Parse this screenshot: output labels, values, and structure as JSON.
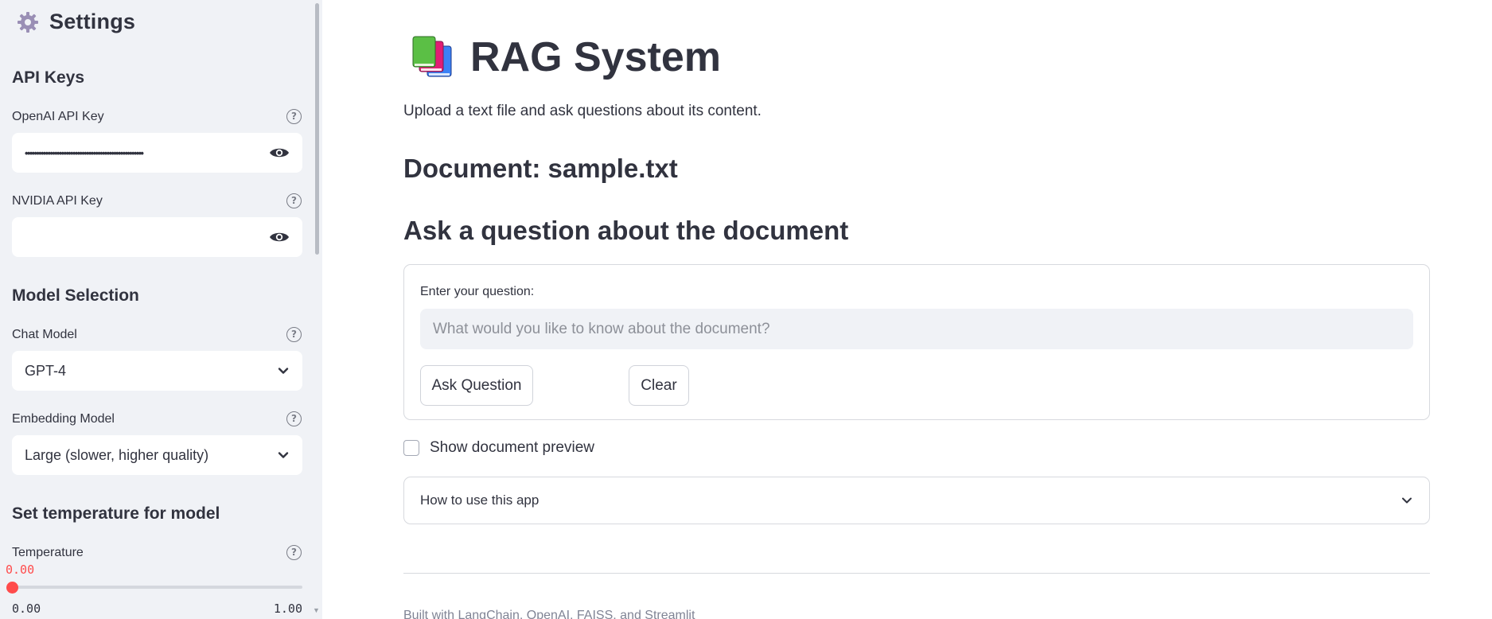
{
  "sidebar": {
    "title": "Settings",
    "icon": "gear-icon",
    "api_section": {
      "heading": "API Keys",
      "openai_label": "OpenAI API Key",
      "openai_value": "••••••••••••••••••••••••••••••••••••••••••••••••••••",
      "nvidia_label": "NVIDIA API Key",
      "nvidia_value": ""
    },
    "model_section": {
      "heading": "Model Selection",
      "chat_label": "Chat Model",
      "chat_value": "GPT-4",
      "embedding_label": "Embedding Model",
      "embedding_value": "Large (slower, higher quality)"
    },
    "temperature_section": {
      "heading": "Set temperature for model",
      "label": "Temperature",
      "value": "0.00",
      "min": "0.00",
      "max": "1.00",
      "fraction": 0.0
    }
  },
  "main": {
    "title": "RAG System",
    "title_icon": "books-icon",
    "subtitle": "Upload a text file and ask questions about its content.",
    "document_heading": "Document: sample.txt",
    "ask_heading": "Ask a question about the document",
    "form": {
      "question_label": "Enter your question:",
      "question_placeholder": "What would you like to know about the document?",
      "question_value": "",
      "ask_button": "Ask Question",
      "clear_button": "Clear"
    },
    "preview_checkbox": {
      "label": "Show document preview",
      "checked": false
    },
    "expander": {
      "label": "How to use this app",
      "expanded": false
    },
    "footer": "Built with LangChain, OpenAI, FAISS, and Streamlit"
  },
  "colors": {
    "accent": "#ff4b4b",
    "sidebar_bg": "#f0f2f6",
    "text": "#31333f"
  }
}
